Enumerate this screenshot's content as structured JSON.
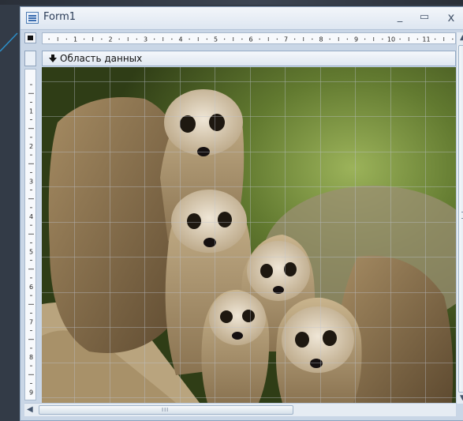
{
  "window": {
    "title": "Form1",
    "minimize_glyph": "_",
    "maximize_glyph": "▭",
    "close_glyph": "x"
  },
  "ruler": {
    "horizontal_numbers": [
      "1",
      "2",
      "3",
      "4",
      "5",
      "6",
      "7",
      "8",
      "9",
      "10",
      "11"
    ],
    "vertical_numbers": [
      "1",
      "2",
      "3",
      "4",
      "5",
      "6",
      "7",
      "8",
      "9"
    ]
  },
  "section": {
    "label": "Область данных",
    "icon": "section-arrow-icon"
  },
  "image": {
    "subject": "meerkats-photo"
  },
  "scrollbar": {
    "grip": "III",
    "left_arrow": "◀",
    "up_arrow": "▲",
    "down_arrow": "▼"
  },
  "colors": {
    "window_frame": "#c9d6e6",
    "backdrop": "#333b47",
    "callout": "#2c8fc9"
  }
}
